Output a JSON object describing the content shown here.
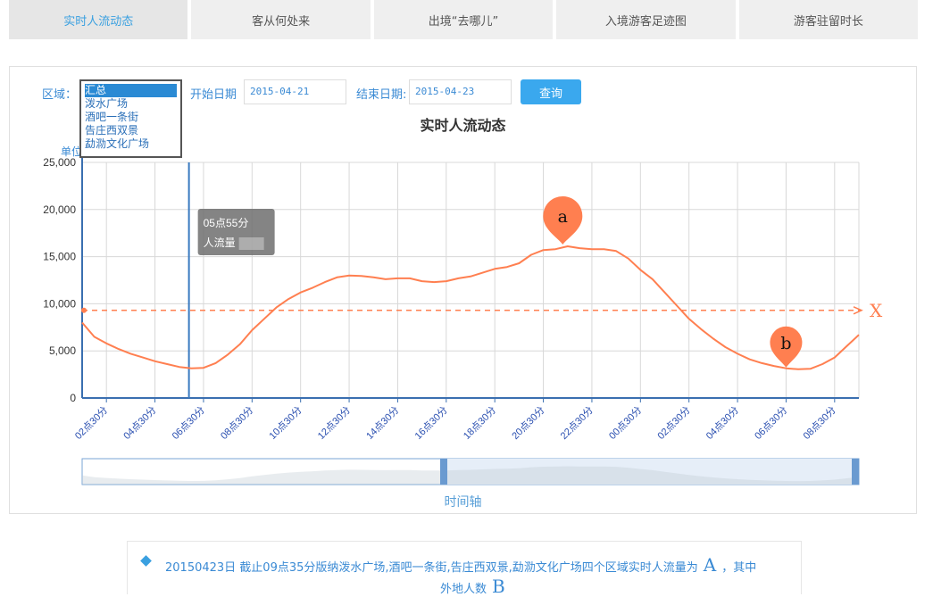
{
  "tabs": [
    {
      "label": "实时人流动态",
      "active": true
    },
    {
      "label": "客从何处来",
      "active": false
    },
    {
      "label": "出境“去哪儿”",
      "active": false
    },
    {
      "label": "入境游客足迹图",
      "active": false
    },
    {
      "label": "游客驻留时长",
      "active": false
    }
  ],
  "filters": {
    "region_label": "区域：",
    "regions": [
      "汇总",
      "泼水广场",
      "酒吧一条街",
      "告庄西双景",
      "勐泐文化广场"
    ],
    "start_label": "开始日期",
    "start_date": "2015-04-21",
    "end_label": "结束日期:",
    "end_date": "2015-04-23",
    "query_button": "查询"
  },
  "chart_data": {
    "type": "line",
    "title": "实时人流动态",
    "ylabel": "单位",
    "ylim": [
      0,
      25000
    ],
    "yticks": [
      "25,000",
      "20,000",
      "15,000",
      "10,000",
      "5,000",
      "0"
    ],
    "ytick_values": [
      25000,
      20000,
      15000,
      10000,
      5000,
      0
    ],
    "xticks": [
      "02点30分",
      "04点30分",
      "06点30分",
      "08点30分",
      "10点30分",
      "12点30分",
      "14点30分",
      "16点30分",
      "18点30分",
      "20点30分",
      "22点30分",
      "00点30分",
      "02点30分",
      "04点30分",
      "06点30分",
      "08点30分"
    ],
    "x_hours": [
      1.5,
      2,
      2.5,
      3,
      3.5,
      4,
      4.5,
      5,
      5.5,
      6,
      6.5,
      7,
      7.5,
      8,
      8.5,
      9,
      9.5,
      10,
      10.5,
      11,
      11.5,
      12,
      12.5,
      13,
      13.5,
      14,
      14.5,
      15,
      15.5,
      16,
      16.5,
      17,
      17.5,
      18,
      18.5,
      19,
      19.5,
      20,
      20.5,
      21,
      21.5,
      22,
      22.5,
      23,
      23.5,
      24,
      24.5,
      25,
      25.5,
      26,
      26.5,
      27,
      27.5,
      28,
      28.5,
      29,
      29.5,
      30,
      30.5,
      31,
      31.5,
      32,
      32.5,
      33,
      33.5
    ],
    "series": [
      {
        "color": "#ff7f50",
        "values": [
          8000,
          6500,
          5800,
          5200,
          4700,
          4300,
          3900,
          3600,
          3300,
          3150,
          3200,
          3700,
          4600,
          5700,
          7200,
          8400,
          9600,
          10500,
          11200,
          11700,
          12300,
          12800,
          13000,
          12950,
          12800,
          12600,
          12700,
          12700,
          12400,
          12300,
          12400,
          12700,
          12900,
          13300,
          13700,
          13900,
          14300,
          15200,
          15700,
          15800,
          16100,
          15900,
          15800,
          15800,
          15600,
          14800,
          13600,
          12600,
          11200,
          9800,
          8400,
          7300,
          6300,
          5400,
          4700,
          4100,
          3700,
          3400,
          3150,
          3050,
          3100,
          3600,
          4300,
          5500,
          6700
        ]
      }
    ],
    "reference_line": {
      "value": 9300,
      "label": "X",
      "color": "#ff7f50"
    },
    "markers": [
      {
        "label": "a",
        "x_hour": 21.3,
        "value": 16100,
        "color": "#ff7f50"
      },
      {
        "label": "b",
        "x_hour": 30.5,
        "value": 3050,
        "color": "#ff7f50"
      }
    ],
    "crosshair": {
      "x_hour": 5.9
    },
    "tooltip": {
      "time": "05点55分",
      "label": "人流量"
    },
    "timeline_label": "时间轴"
  },
  "footer": {
    "text_main": "20150423日 截止09点35分版纳泼水广场,酒吧一条街,告庄西双景,勐泐文化广场四个区域实时人流量为",
    "mark_a": "A",
    "text_mid": "，其中",
    "text_second": "外地人数",
    "mark_b": "B"
  }
}
